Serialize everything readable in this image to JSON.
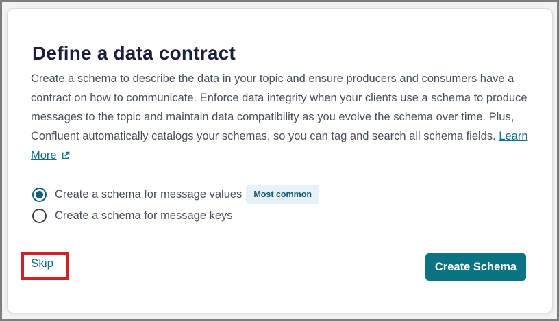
{
  "dialog": {
    "title": "Define a data contract",
    "description": "Create a schema to describe the data in your topic and ensure producers and consumers have a contract on how to communicate. Enforce data integrity when your clients use a schema to produce messages to the topic and maintain data compatibility as you evolve the schema over time. Plus, Confluent automatically catalogs your schemas, so you can tag and search all schema fields.",
    "learn_more": "Learn More",
    "learn_more_icon": "external-link-icon",
    "options": [
      {
        "label": "Create a schema for message values",
        "checked": true,
        "badge": "Most common"
      },
      {
        "label": "Create a schema for message keys",
        "checked": false
      }
    ],
    "skip_label": "Skip",
    "create_label": "Create Schema"
  },
  "colors": {
    "accent": "#0b7382",
    "link": "#0f6f8c",
    "highlight": "#d1202a",
    "badge_bg": "#e6f2f8"
  }
}
